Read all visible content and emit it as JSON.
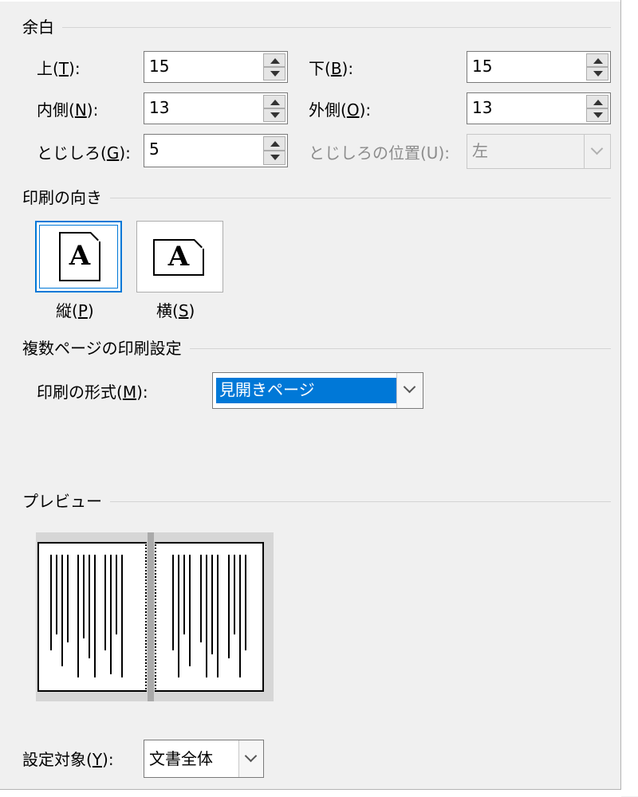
{
  "margins": {
    "title": "余白",
    "top": {
      "label_pre": "上(",
      "key": "T",
      "label_post": "):",
      "value": "15"
    },
    "bottom": {
      "label_pre": "下(",
      "key": "B",
      "label_post": "):",
      "value": "15"
    },
    "inner": {
      "label_pre": "内側(",
      "key": "N",
      "label_post": "):",
      "value": "13"
    },
    "outer": {
      "label_pre": "外側(",
      "key": "O",
      "label_post": "):",
      "value": "13"
    },
    "gutter": {
      "label_pre": "とじしろ(",
      "key": "G",
      "label_post": "):",
      "value": "5"
    },
    "gutter_position": {
      "label": "とじしろの位置(U):",
      "value": "左"
    }
  },
  "orientation": {
    "title": "印刷の向き",
    "portrait": {
      "label_pre": "縦(",
      "key": "P",
      "label_post": ")",
      "icon_letter": "A"
    },
    "landscape": {
      "label_pre": "横(",
      "key": "S",
      "label_post": ")",
      "icon_letter": "A"
    }
  },
  "multiple_pages": {
    "title": "複数ページの印刷設定",
    "format": {
      "label_pre": "印刷の形式(",
      "key": "M",
      "label_post": "):",
      "value": "見開きページ"
    }
  },
  "preview": {
    "title": "プレビュー"
  },
  "apply_to": {
    "label_pre": "設定対象(",
    "key": "Y",
    "label_post": "):",
    "value": "文書全体"
  },
  "colors": {
    "accent": "#0078d7",
    "background": "#f0f0f0"
  }
}
